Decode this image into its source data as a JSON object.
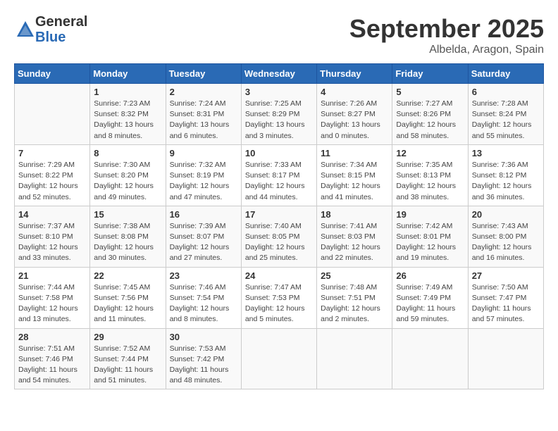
{
  "header": {
    "logo_general": "General",
    "logo_blue": "Blue",
    "month_title": "September 2025",
    "location": "Albelda, Aragon, Spain"
  },
  "days_of_week": [
    "Sunday",
    "Monday",
    "Tuesday",
    "Wednesday",
    "Thursday",
    "Friday",
    "Saturday"
  ],
  "weeks": [
    [
      {
        "num": "",
        "info": ""
      },
      {
        "num": "1",
        "info": "Sunrise: 7:23 AM\nSunset: 8:32 PM\nDaylight: 13 hours\nand 8 minutes."
      },
      {
        "num": "2",
        "info": "Sunrise: 7:24 AM\nSunset: 8:31 PM\nDaylight: 13 hours\nand 6 minutes."
      },
      {
        "num": "3",
        "info": "Sunrise: 7:25 AM\nSunset: 8:29 PM\nDaylight: 13 hours\nand 3 minutes."
      },
      {
        "num": "4",
        "info": "Sunrise: 7:26 AM\nSunset: 8:27 PM\nDaylight: 13 hours\nand 0 minutes."
      },
      {
        "num": "5",
        "info": "Sunrise: 7:27 AM\nSunset: 8:26 PM\nDaylight: 12 hours\nand 58 minutes."
      },
      {
        "num": "6",
        "info": "Sunrise: 7:28 AM\nSunset: 8:24 PM\nDaylight: 12 hours\nand 55 minutes."
      }
    ],
    [
      {
        "num": "7",
        "info": "Sunrise: 7:29 AM\nSunset: 8:22 PM\nDaylight: 12 hours\nand 52 minutes."
      },
      {
        "num": "8",
        "info": "Sunrise: 7:30 AM\nSunset: 8:20 PM\nDaylight: 12 hours\nand 49 minutes."
      },
      {
        "num": "9",
        "info": "Sunrise: 7:32 AM\nSunset: 8:19 PM\nDaylight: 12 hours\nand 47 minutes."
      },
      {
        "num": "10",
        "info": "Sunrise: 7:33 AM\nSunset: 8:17 PM\nDaylight: 12 hours\nand 44 minutes."
      },
      {
        "num": "11",
        "info": "Sunrise: 7:34 AM\nSunset: 8:15 PM\nDaylight: 12 hours\nand 41 minutes."
      },
      {
        "num": "12",
        "info": "Sunrise: 7:35 AM\nSunset: 8:13 PM\nDaylight: 12 hours\nand 38 minutes."
      },
      {
        "num": "13",
        "info": "Sunrise: 7:36 AM\nSunset: 8:12 PM\nDaylight: 12 hours\nand 36 minutes."
      }
    ],
    [
      {
        "num": "14",
        "info": "Sunrise: 7:37 AM\nSunset: 8:10 PM\nDaylight: 12 hours\nand 33 minutes."
      },
      {
        "num": "15",
        "info": "Sunrise: 7:38 AM\nSunset: 8:08 PM\nDaylight: 12 hours\nand 30 minutes."
      },
      {
        "num": "16",
        "info": "Sunrise: 7:39 AM\nSunset: 8:07 PM\nDaylight: 12 hours\nand 27 minutes."
      },
      {
        "num": "17",
        "info": "Sunrise: 7:40 AM\nSunset: 8:05 PM\nDaylight: 12 hours\nand 25 minutes."
      },
      {
        "num": "18",
        "info": "Sunrise: 7:41 AM\nSunset: 8:03 PM\nDaylight: 12 hours\nand 22 minutes."
      },
      {
        "num": "19",
        "info": "Sunrise: 7:42 AM\nSunset: 8:01 PM\nDaylight: 12 hours\nand 19 minutes."
      },
      {
        "num": "20",
        "info": "Sunrise: 7:43 AM\nSunset: 8:00 PM\nDaylight: 12 hours\nand 16 minutes."
      }
    ],
    [
      {
        "num": "21",
        "info": "Sunrise: 7:44 AM\nSunset: 7:58 PM\nDaylight: 12 hours\nand 13 minutes."
      },
      {
        "num": "22",
        "info": "Sunrise: 7:45 AM\nSunset: 7:56 PM\nDaylight: 12 hours\nand 11 minutes."
      },
      {
        "num": "23",
        "info": "Sunrise: 7:46 AM\nSunset: 7:54 PM\nDaylight: 12 hours\nand 8 minutes."
      },
      {
        "num": "24",
        "info": "Sunrise: 7:47 AM\nSunset: 7:53 PM\nDaylight: 12 hours\nand 5 minutes."
      },
      {
        "num": "25",
        "info": "Sunrise: 7:48 AM\nSunset: 7:51 PM\nDaylight: 12 hours\nand 2 minutes."
      },
      {
        "num": "26",
        "info": "Sunrise: 7:49 AM\nSunset: 7:49 PM\nDaylight: 11 hours\nand 59 minutes."
      },
      {
        "num": "27",
        "info": "Sunrise: 7:50 AM\nSunset: 7:47 PM\nDaylight: 11 hours\nand 57 minutes."
      }
    ],
    [
      {
        "num": "28",
        "info": "Sunrise: 7:51 AM\nSunset: 7:46 PM\nDaylight: 11 hours\nand 54 minutes."
      },
      {
        "num": "29",
        "info": "Sunrise: 7:52 AM\nSunset: 7:44 PM\nDaylight: 11 hours\nand 51 minutes."
      },
      {
        "num": "30",
        "info": "Sunrise: 7:53 AM\nSunset: 7:42 PM\nDaylight: 11 hours\nand 48 minutes."
      },
      {
        "num": "",
        "info": ""
      },
      {
        "num": "",
        "info": ""
      },
      {
        "num": "",
        "info": ""
      },
      {
        "num": "",
        "info": ""
      }
    ]
  ]
}
